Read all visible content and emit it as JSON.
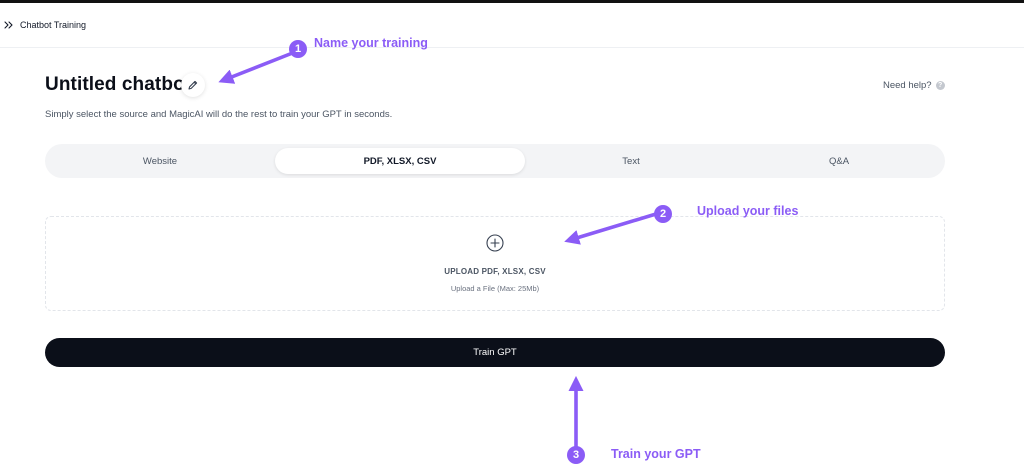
{
  "topbar": {
    "title": "Chatbot Training",
    "collapse_icon": "double-chevron-right-icon"
  },
  "header": {
    "title": "Untitled chatbot",
    "edit_icon": "pencil-icon",
    "subtitle": "Simply select the source and MagicAI will do the rest to train your GPT in seconds.",
    "help_label": "Need help?",
    "help_icon": "question-circle-icon"
  },
  "tabs": [
    {
      "label": "Website",
      "active": false
    },
    {
      "label": "PDF, XLSX, CSV",
      "active": true
    },
    {
      "label": "Text",
      "active": false
    },
    {
      "label": "Q&A",
      "active": false
    }
  ],
  "upload": {
    "icon": "plus-circle-icon",
    "title": "UPLOAD PDF, XLSX, CSV",
    "hint": "Upload a File (Max: 25Mb)"
  },
  "train_button": {
    "label": "Train GPT"
  },
  "annotations": [
    {
      "number": "1",
      "label": "Name your training"
    },
    {
      "number": "2",
      "label": "Upload your files"
    },
    {
      "number": "3",
      "label": "Train your GPT"
    }
  ],
  "colors": {
    "accent": "#8b5cf6",
    "button_dark": "#0b0f19",
    "tab_track": "#f3f4f6"
  }
}
